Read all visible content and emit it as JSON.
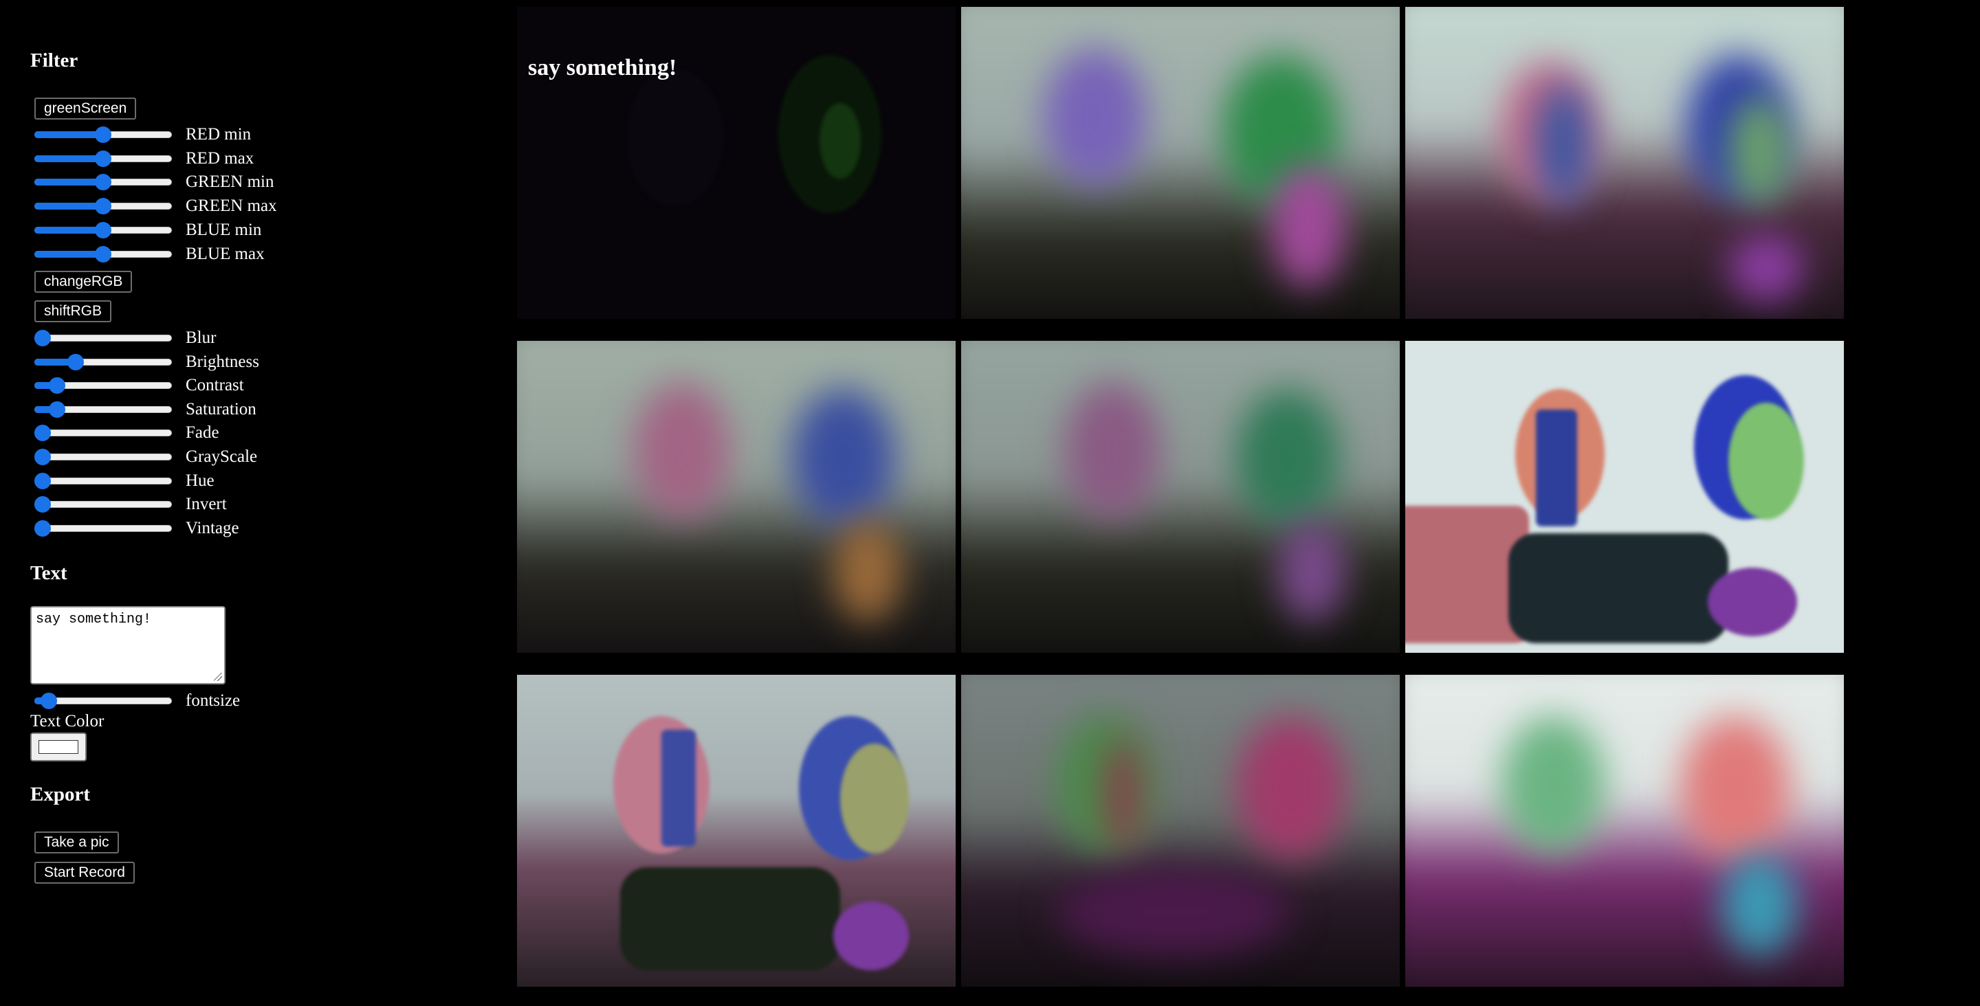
{
  "filter": {
    "heading": "Filter",
    "green_screen_button": "greenScreen",
    "rgb_sliders": [
      {
        "label": "RED min",
        "value": 0.5
      },
      {
        "label": "RED max",
        "value": 0.5
      },
      {
        "label": "GREEN min",
        "value": 0.5
      },
      {
        "label": "GREEN max",
        "value": 0.5
      },
      {
        "label": "BLUE min",
        "value": 0.5
      },
      {
        "label": "BLUE max",
        "value": 0.5
      }
    ],
    "change_rgb_button": "changeRGB",
    "shift_rgb_button": "shiftRGB",
    "effect_sliders": [
      {
        "label": "Blur",
        "value": 0.0
      },
      {
        "label": "Brightness",
        "value": 0.27
      },
      {
        "label": "Contrast",
        "value": 0.12
      },
      {
        "label": "Saturation",
        "value": 0.12
      },
      {
        "label": "Fade",
        "value": 0.0
      },
      {
        "label": "GrayScale",
        "value": 0.0
      },
      {
        "label": "Hue",
        "value": 0.0
      },
      {
        "label": "Invert",
        "value": 0.0
      },
      {
        "label": "Vintage",
        "value": 0.0
      }
    ]
  },
  "text": {
    "heading": "Text",
    "textarea_value": "say something!",
    "fontsize_label": "fontsize",
    "fontsize_value": 0.05,
    "text_color_label": "Text Color",
    "text_color_value": "#ffffff"
  },
  "export": {
    "heading": "Export",
    "take_pic_button": "Take a pic",
    "start_record_button": "Start Record"
  },
  "video": {
    "overlay_text": "say something!",
    "tiles": [
      {
        "name": "dark-green-filter"
      },
      {
        "name": "blur-pastel"
      },
      {
        "name": "rgb-shift-blur"
      },
      {
        "name": "blur-warm"
      },
      {
        "name": "blur-cool"
      },
      {
        "name": "rgb-shift-sharp"
      },
      {
        "name": "rgb-shift-mild"
      },
      {
        "name": "blur-dark"
      },
      {
        "name": "blur-bright"
      }
    ]
  }
}
